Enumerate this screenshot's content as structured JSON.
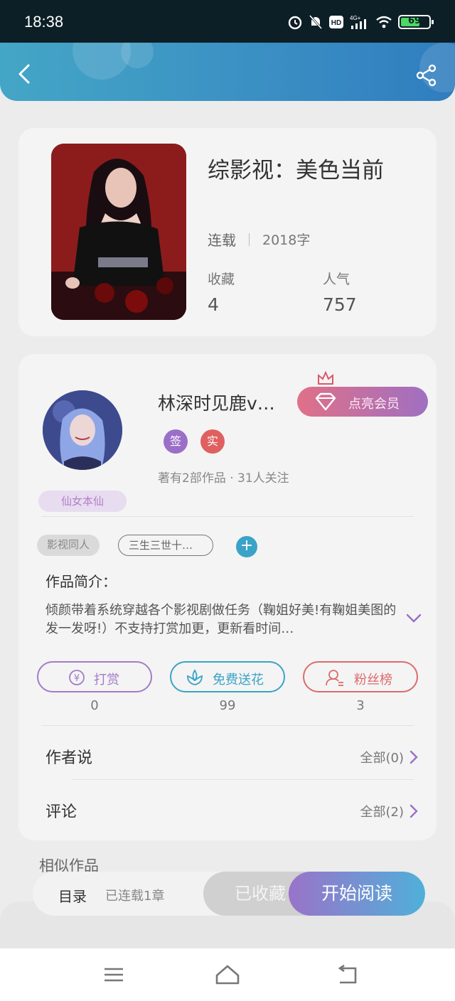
{
  "status_bar": {
    "time": "18:38",
    "battery": "69"
  },
  "book": {
    "title": "综影视：美色当前",
    "status": "连载",
    "word_count": "2018字",
    "favorites_label": "收藏",
    "favorites_value": "4",
    "popularity_label": "人气",
    "popularity_value": "757"
  },
  "author": {
    "name": "林深时见鹿v…",
    "badge": "仙女本仙",
    "vip_button": "点亮会员",
    "tag_sign": "签",
    "tag_real": "实",
    "works_info": "著有2部作品 · 31人关注"
  },
  "tags": {
    "genre": "影视同人",
    "topic": "三生三世十…",
    "add": "+"
  },
  "intro": {
    "label": "作品简介：",
    "text": "倾颜带着系统穿越各个影视剧做任务（鞠姐好美!有鞠姐美图的发一发呀!）不支持打赏加更，更新看时间…"
  },
  "actions": [
    {
      "label": "打赏",
      "count": "0",
      "color": "#a27cc8"
    },
    {
      "label": "免费送花",
      "count": "99",
      "color": "#3aa3c7"
    },
    {
      "label": "粉丝榜",
      "count": "3",
      "color": "#dd6b6b"
    }
  ],
  "author_says": {
    "label": "作者说",
    "right": "全部(0)"
  },
  "comments": {
    "label": "评论",
    "right": "全部(2)"
  },
  "similar_label": "相似作品",
  "read_bar": {
    "toc": "目录",
    "chapters": "已连载1章",
    "favorited": "已收藏",
    "start_reading": "开始阅读"
  },
  "colors": {
    "header": "#3a8ec3",
    "accent_purple": "#a27cc8",
    "accent_blue": "#3aa3c7",
    "accent_red": "#dd6b6b"
  }
}
